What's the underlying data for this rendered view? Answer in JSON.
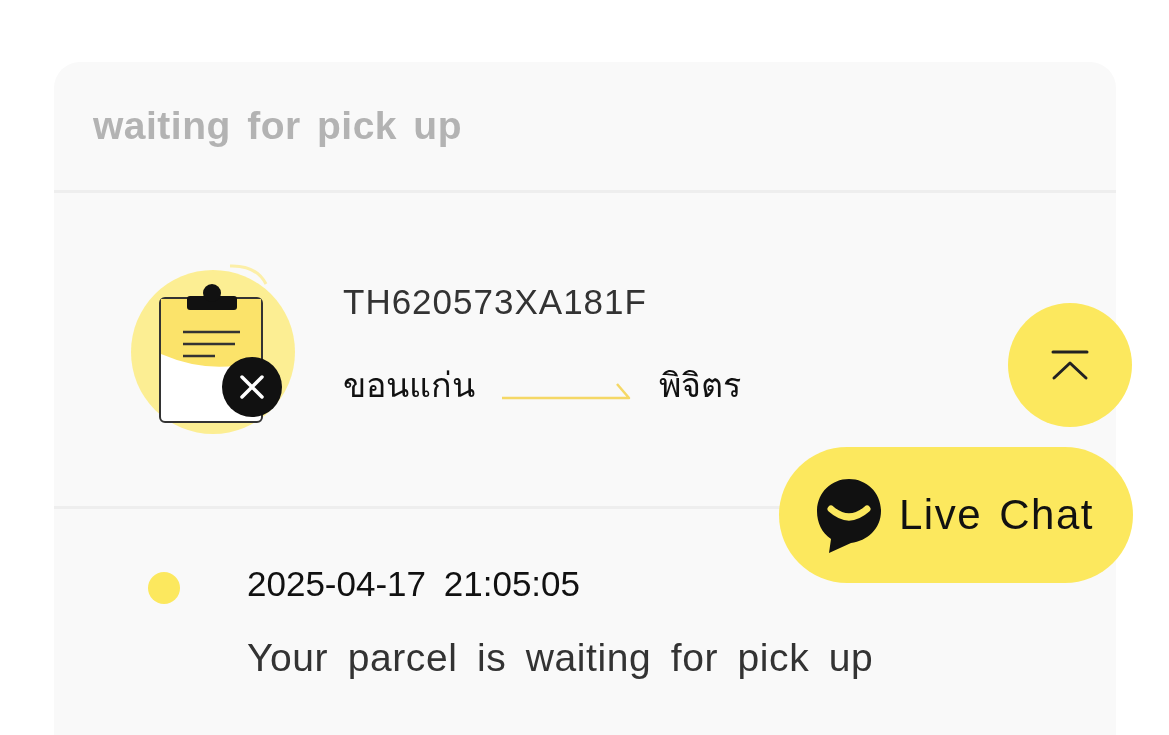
{
  "status_header": {
    "title": "waiting for pick up"
  },
  "parcel": {
    "tracking_number": "TH620573XA181F",
    "origin": "ขอนแก่น",
    "destination": "พิจิตร"
  },
  "timeline": [
    {
      "time": "2025-04-17 21:05:05",
      "message": "Your parcel is waiting for pick up"
    }
  ],
  "floating_actions": [
    {
      "kind": "back_to_top"
    },
    {
      "kind": "live_chat",
      "label": "Live Chat"
    }
  ]
}
